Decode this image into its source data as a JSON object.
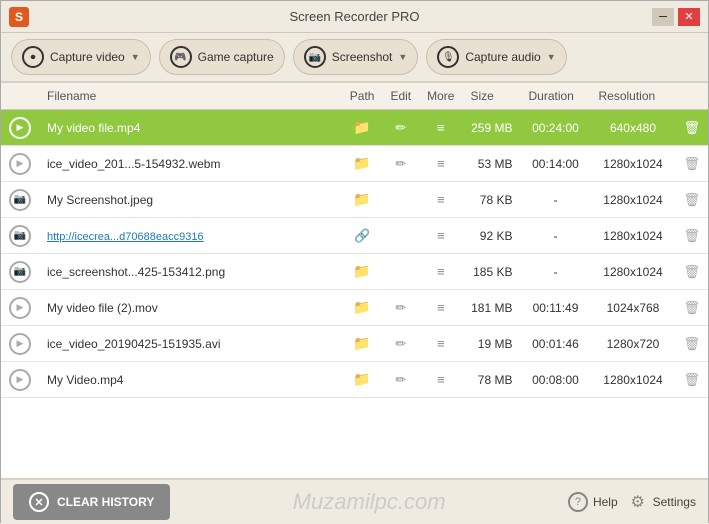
{
  "titleBar": {
    "appIcon": "S",
    "title": "Screen Recorder PRO",
    "minimizeBtn": "─",
    "closeBtn": "✕"
  },
  "toolbar": {
    "captureVideo": "Capture video",
    "gameCapture": "Game capture",
    "screenshot": "Screenshot",
    "captureAudio": "Capture audio"
  },
  "table": {
    "headers": {
      "filename": "Filename",
      "path": "Path",
      "edit": "Edit",
      "more": "More",
      "size": "Size",
      "duration": "Duration",
      "resolution": "Resolution"
    },
    "rows": [
      {
        "type": "video",
        "selected": true,
        "filename": "My video file.mp4",
        "hasFolder": true,
        "hasEdit": true,
        "size": "259 MB",
        "duration": "00:24:00",
        "resolution": "640x480"
      },
      {
        "type": "video",
        "selected": false,
        "filename": "ice_video_201...5-154932.webm",
        "hasFolder": true,
        "hasEdit": true,
        "size": "53 MB",
        "duration": "00:14:00",
        "resolution": "1280x1024"
      },
      {
        "type": "screenshot",
        "selected": false,
        "filename": "My Screenshot.jpeg",
        "hasFolder": true,
        "hasEdit": false,
        "size": "78 KB",
        "duration": "-",
        "resolution": "1280x1024"
      },
      {
        "type": "screenshot",
        "selected": false,
        "filename": "http://icecrea...d70688eacc9316",
        "isLink": true,
        "hasFolder": false,
        "hasLink": true,
        "hasEdit": false,
        "size": "92 KB",
        "duration": "-",
        "resolution": "1280x1024"
      },
      {
        "type": "screenshot",
        "selected": false,
        "filename": "ice_screenshot...425-153412.png",
        "hasFolder": true,
        "hasEdit": false,
        "size": "185 KB",
        "duration": "-",
        "resolution": "1280x1024"
      },
      {
        "type": "video",
        "selected": false,
        "filename": "My video file (2).mov",
        "hasFolder": true,
        "hasEdit": true,
        "size": "181 MB",
        "duration": "00:11:49",
        "resolution": "1024x768"
      },
      {
        "type": "video",
        "selected": false,
        "filename": "ice_video_20190425-151935.avi",
        "hasFolder": true,
        "hasEdit": true,
        "size": "19 MB",
        "duration": "00:01:46",
        "resolution": "1280x720"
      },
      {
        "type": "video",
        "selected": false,
        "filename": "My Video.mp4",
        "hasFolder": true,
        "hasEdit": true,
        "size": "78 MB",
        "duration": "00:08:00",
        "resolution": "1280x1024"
      }
    ]
  },
  "footer": {
    "clearHistory": "CLEAR HISTORY",
    "watermark": "Muzamilpc.com",
    "helpLabel": "Help",
    "settingsLabel": "Settings"
  }
}
